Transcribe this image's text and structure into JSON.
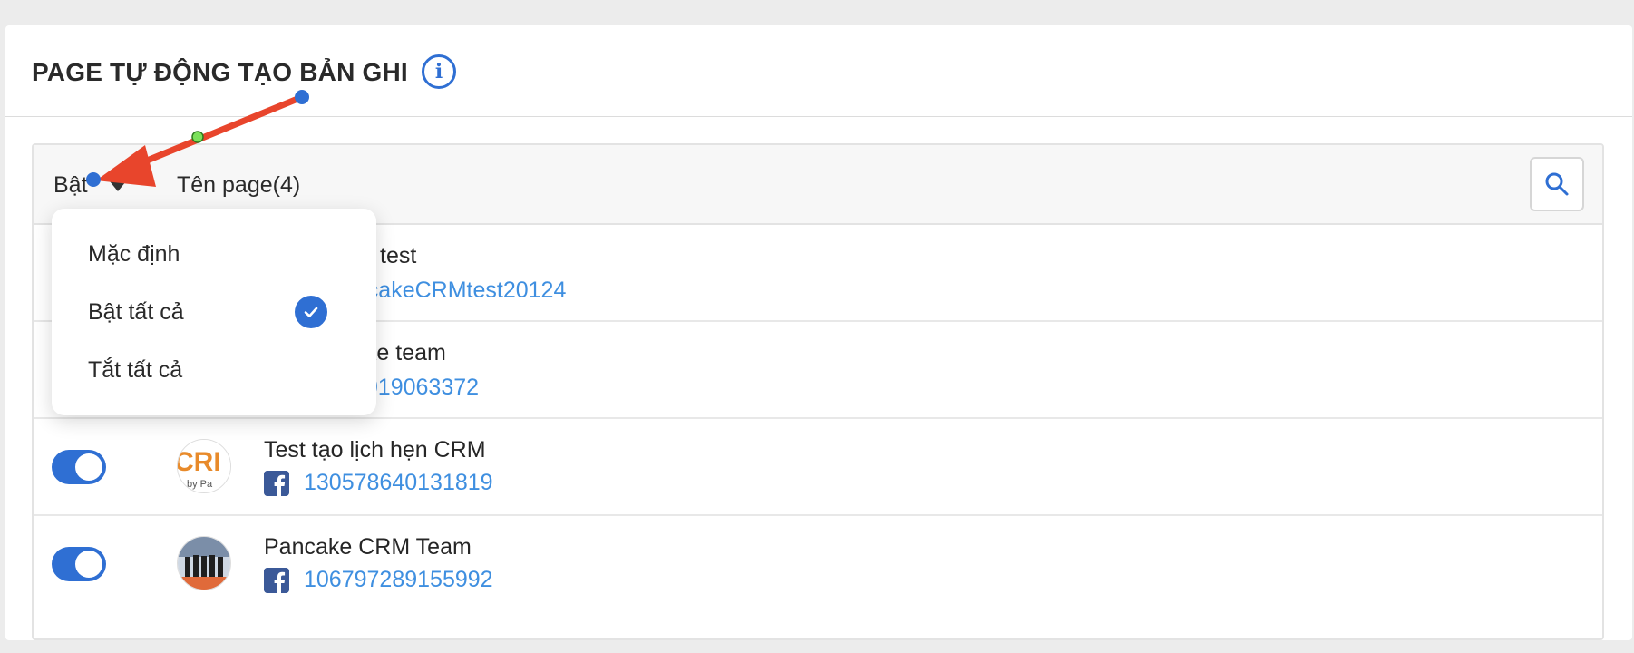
{
  "header": {
    "title": "PAGE TỰ ĐỘNG TẠO BẢN GHI",
    "info_icon": "info-icon"
  },
  "table": {
    "col_enabled_label": "Bật",
    "col_name_label": "Tên page(4)",
    "search_icon": "search-icon",
    "rows": [
      {
        "name": "test",
        "id": "ancakeCRMtest20124",
        "enabled": true
      },
      {
        "name": "ake team",
        "id": "3019063372",
        "enabled": true
      },
      {
        "name": "Test tạo lịch hẹn CRM",
        "id": "130578640131819",
        "enabled": true
      },
      {
        "name": "Pancake CRM Team",
        "id": "106797289155992",
        "enabled": true
      }
    ]
  },
  "dropdown": {
    "items": [
      "Mặc định",
      "Bật tất cả",
      "Tắt tất cả"
    ],
    "selected": "Bật tất cả"
  },
  "colors": {
    "accent": "#2f6fd3",
    "link": "#3f8fe0",
    "annotation_arrow": "#e8452c"
  }
}
